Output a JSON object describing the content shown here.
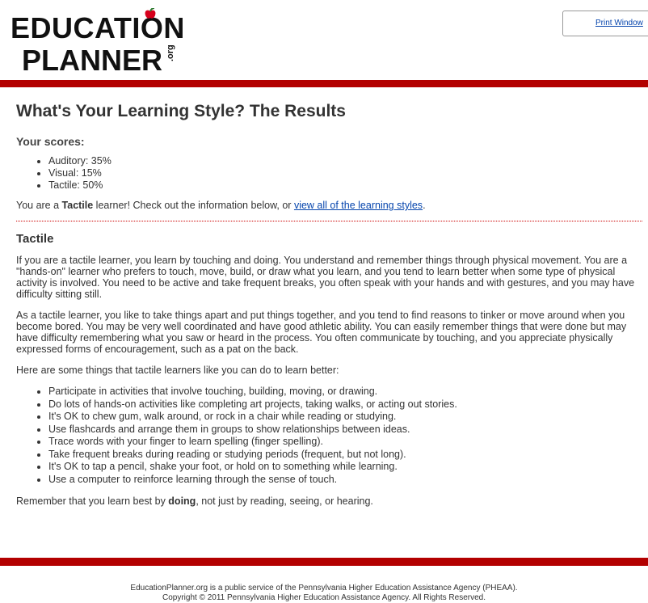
{
  "logo": {
    "line1": "EDUCATION",
    "line2": "PLANNER",
    "org": ".org"
  },
  "print_button": {
    "label": "Print Window"
  },
  "colors": {
    "accent_bar": "#b30000",
    "link": "#0645ad"
  },
  "page": {
    "title": "What's Your Learning Style? The Results",
    "scores_heading": "Your scores:",
    "scores": [
      "Auditory: 35%",
      "Visual: 15%",
      "Tactile: 50%"
    ],
    "result_prefix": "You are a ",
    "result_style": "Tactile",
    "result_mid": " learner! Check out the information below, or ",
    "result_link": "view all of the learning styles",
    "result_suffix": "."
  },
  "tactile": {
    "heading": "Tactile",
    "para1": "If you are a tactile learner, you learn by touching and doing. You understand and remember things through physical movement. You are a \"hands-on\" learner who prefers to touch, move, build, or draw what you learn, and you tend to learn better when some type of physical activity is involved. You need to be active and take frequent breaks, you often speak with your hands and with gestures, and you may have difficulty sitting still.",
    "para2": "As a tactile learner, you like to take things apart and put things together, and you tend to find reasons to tinker or move around when you become bored. You may be very well coordinated and have good athletic ability. You can easily remember things that were done but may have difficulty remembering what you saw or heard in the process. You often communicate by touching, and you appreciate physically expressed forms of encouragement, such as a pat on the back.",
    "tips_intro": "Here are some things that tactile learners like you can do to learn better:",
    "tips": [
      "Participate in activities that involve touching, building, moving, or drawing.",
      "Do lots of hands-on activities like completing art projects, taking walks, or acting out stories.",
      "It's OK to chew gum, walk around, or rock in a chair while reading or studying.",
      "Use flashcards and arrange them in groups to show relationships between ideas.",
      "Trace words with your finger to learn spelling (finger spelling).",
      "Take frequent breaks during reading or studying periods (frequent, but not long).",
      "It's OK to tap a pencil, shake your foot, or hold on to something while learning.",
      "Use a computer to reinforce learning through the sense of touch."
    ],
    "closing_prefix": "Remember that you learn best by ",
    "closing_bold": "doing",
    "closing_suffix": ", not just by reading, seeing, or hearing."
  },
  "footer": {
    "line1": "EducationPlanner.org is a public service of the Pennsylvania Higher Education Assistance Agency (PHEAA).",
    "line2": "Copyright © 2011 Pennsylvania Higher Education Assistance Agency. All Rights Reserved."
  }
}
